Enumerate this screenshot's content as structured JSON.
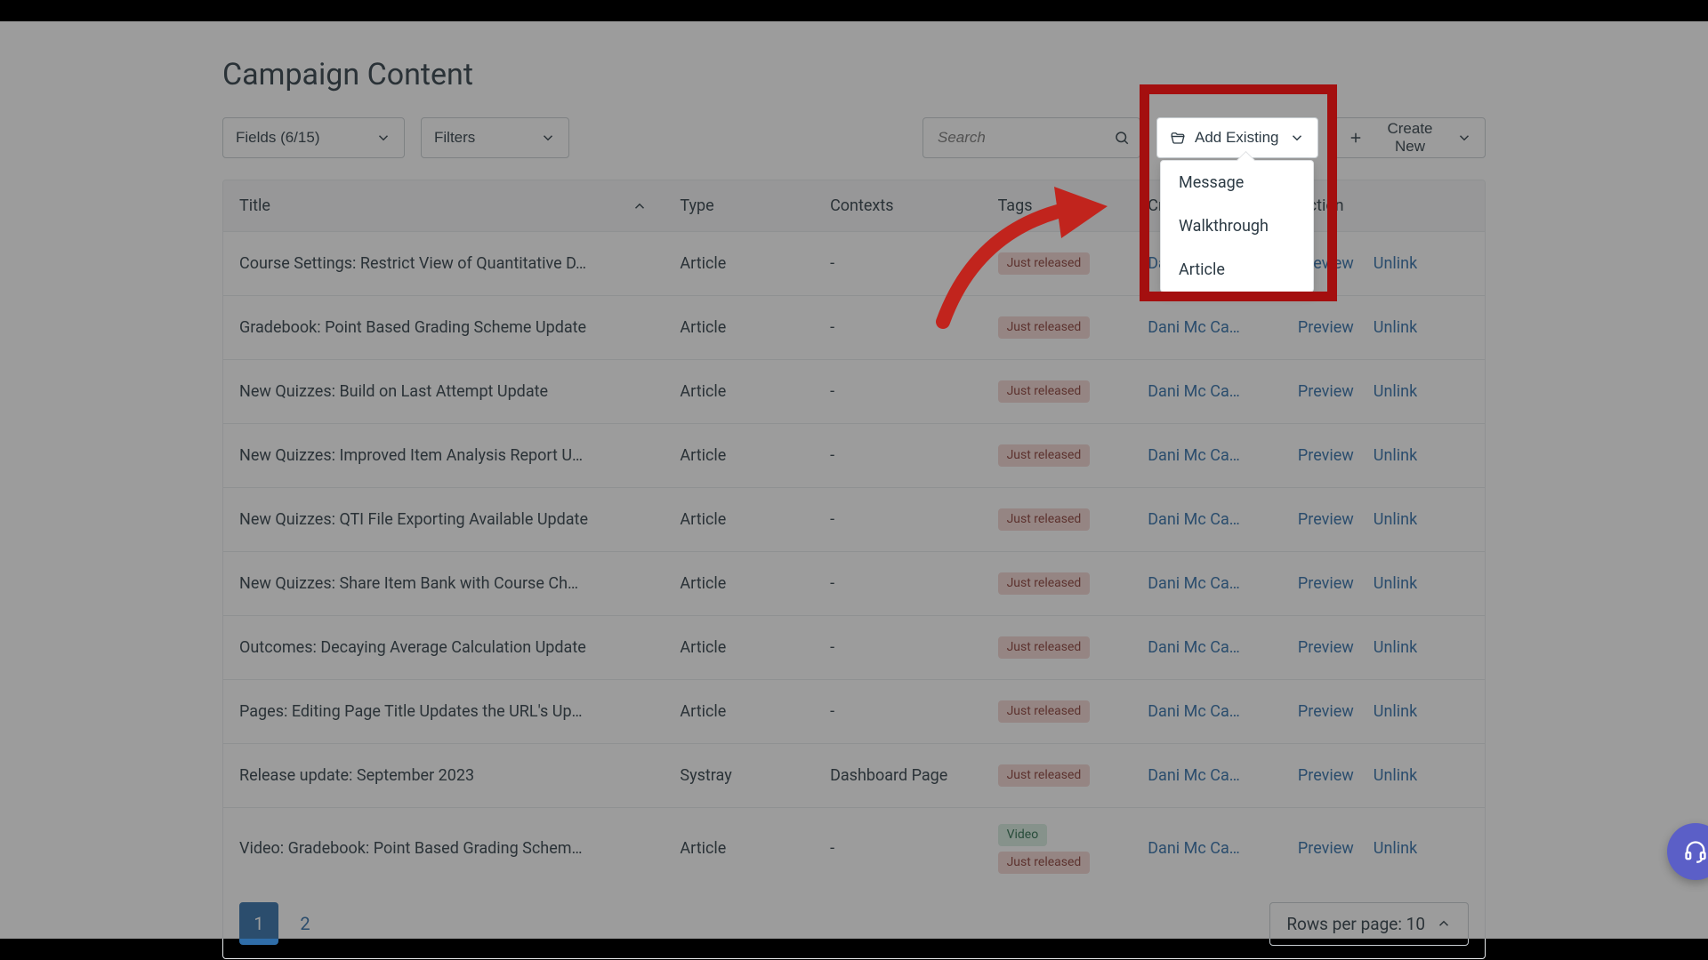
{
  "page": {
    "title": "Campaign Content"
  },
  "toolbar": {
    "fields_label": "Fields (6/15)",
    "filters_label": "Filters",
    "search_placeholder": "Search",
    "add_existing_label": "Add Existing",
    "create_new_label": "Create New"
  },
  "add_existing_menu": {
    "items": [
      "Message",
      "Walkthrough",
      "Article"
    ]
  },
  "table": {
    "headers": {
      "title": "Title",
      "type": "Type",
      "contexts": "Contexts",
      "tags": "Tags",
      "created_by": "Created by",
      "action": "Action"
    },
    "action_labels": {
      "preview": "Preview",
      "unlink": "Unlink"
    },
    "rows": [
      {
        "title": "Course Settings: Restrict View of Quantitative D…",
        "type": "Article",
        "contexts": "-",
        "tags": [
          "Just released"
        ],
        "created_by": "Dani Mc Ca…"
      },
      {
        "title": "Gradebook: Point Based Grading Scheme Update",
        "type": "Article",
        "contexts": "-",
        "tags": [
          "Just released"
        ],
        "created_by": "Dani Mc Ca…"
      },
      {
        "title": "New Quizzes: Build on Last Attempt Update",
        "type": "Article",
        "contexts": "-",
        "tags": [
          "Just released"
        ],
        "created_by": "Dani Mc Ca…"
      },
      {
        "title": "New Quizzes: Improved Item Analysis Report U…",
        "type": "Article",
        "contexts": "-",
        "tags": [
          "Just released"
        ],
        "created_by": "Dani Mc Ca…"
      },
      {
        "title": "New Quizzes: QTI File Exporting Available Update",
        "type": "Article",
        "contexts": "-",
        "tags": [
          "Just released"
        ],
        "created_by": "Dani Mc Ca…"
      },
      {
        "title": "New Quizzes: Share Item Bank with Course Ch…",
        "type": "Article",
        "contexts": "-",
        "tags": [
          "Just released"
        ],
        "created_by": "Dani Mc Ca…"
      },
      {
        "title": "Outcomes: Decaying Average Calculation Update",
        "type": "Article",
        "contexts": "-",
        "tags": [
          "Just released"
        ],
        "created_by": "Dani Mc Ca…"
      },
      {
        "title": "Pages: Editing Page Title Updates the URL's Up…",
        "type": "Article",
        "contexts": "-",
        "tags": [
          "Just released"
        ],
        "created_by": "Dani Mc Ca…"
      },
      {
        "title": "Release update: September 2023",
        "type": "Systray",
        "contexts": "Dashboard Page",
        "tags": [
          "Just released"
        ],
        "created_by": "Dani Mc Ca…"
      },
      {
        "title": "Video: Gradebook: Point Based Grading Schem…",
        "type": "Article",
        "contexts": "-",
        "tags": [
          "Video",
          "Just released"
        ],
        "created_by": "Dani Mc Ca…"
      }
    ]
  },
  "pagination": {
    "pages": [
      "1",
      "2"
    ],
    "active_index": 0,
    "rows_per_page_label": "Rows per page: 10"
  },
  "tag_styles": {
    "Just released": "badge-red",
    "Video": "badge-green"
  }
}
